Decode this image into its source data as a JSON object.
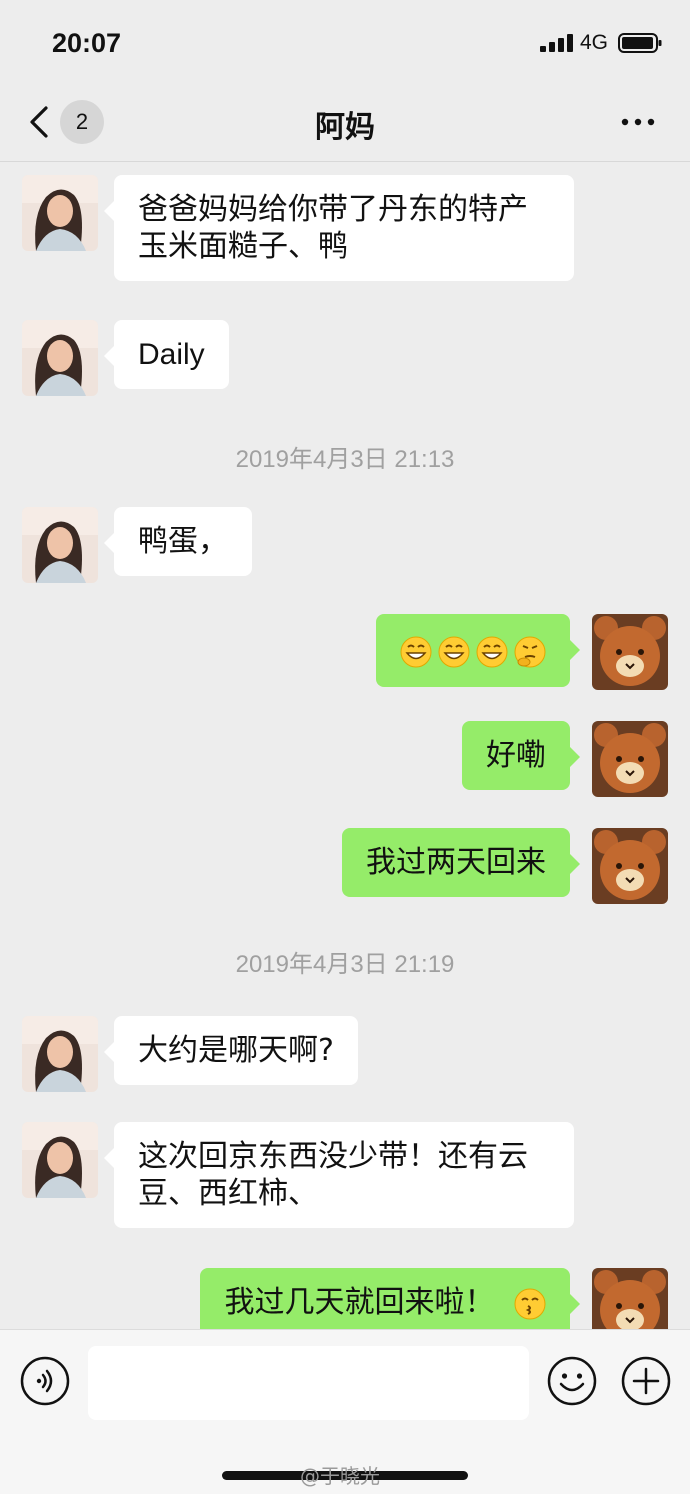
{
  "status_bar": {
    "time": "20:07",
    "network": "4G"
  },
  "nav": {
    "unread_count": "2",
    "title": "阿妈"
  },
  "messages": [
    {
      "type": "in",
      "text": "爸爸妈妈给你带了丹东的特产玉米面糙子、鸭"
    },
    {
      "type": "in",
      "text": "Daily"
    },
    {
      "type": "time",
      "text": "2019年4月3日 21:13"
    },
    {
      "type": "in",
      "text": "鸭蛋，"
    },
    {
      "type": "out",
      "text": "",
      "emoji": [
        "grin-emoji",
        "grin-emoji",
        "grin-emoji",
        "thinking-emoji"
      ]
    },
    {
      "type": "out",
      "text": "好嘞"
    },
    {
      "type": "out",
      "text": "我过两天回来"
    },
    {
      "type": "time",
      "text": "2019年4月3日 21:19"
    },
    {
      "type": "in",
      "text": "大约是哪天啊?"
    },
    {
      "type": "in",
      "text": "这次回京东西没少带！还有云豆、西红柿、"
    },
    {
      "type": "out",
      "text": "我过几天就回来啦！",
      "emoji": [
        "kiss-emoji"
      ]
    }
  ],
  "watermark": "@于晓光",
  "colors": {
    "background": "#ededed",
    "outgoing_bubble": "#95ec69",
    "incoming_bubble": "#ffffff"
  }
}
